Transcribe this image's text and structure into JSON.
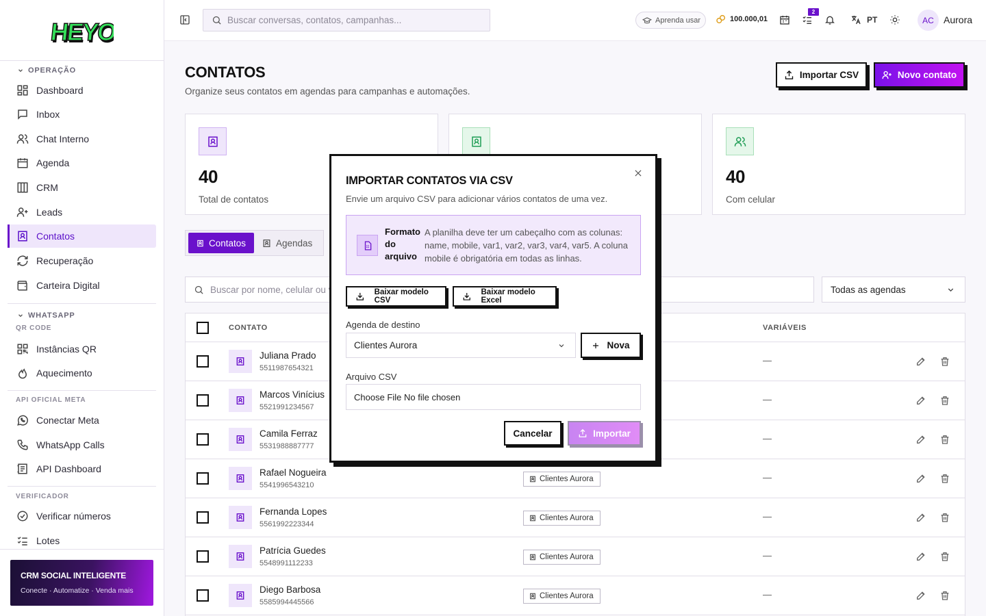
{
  "brand": {
    "logo_text": "HEYOO"
  },
  "sidebar": {
    "sections": [
      {
        "title": "OPERAÇÃO"
      },
      {
        "title": "WHATSAPP",
        "subtitle": "QR CODE"
      },
      {
        "title": "API OFICIAL META"
      },
      {
        "title": "VERIFICADOR"
      }
    ],
    "items": [
      {
        "label": "Dashboard",
        "icon": "grid-icon"
      },
      {
        "label": "Inbox",
        "icon": "inbox-icon"
      },
      {
        "label": "Chat Interno",
        "icon": "users-icon"
      },
      {
        "label": "Agenda",
        "icon": "calendar-icon"
      },
      {
        "label": "CRM",
        "icon": "columns-icon"
      },
      {
        "label": "Leads",
        "icon": "user-plus-icon"
      },
      {
        "label": "Contatos",
        "icon": "contact-book-icon",
        "active": true
      },
      {
        "label": "Recuperação",
        "icon": "refresh-icon"
      },
      {
        "label": "Carteira Digital",
        "icon": "wallet-icon"
      },
      {
        "label": "Instâncias QR",
        "icon": "qr-code-icon"
      },
      {
        "label": "Aquecimento",
        "icon": "flame-icon"
      },
      {
        "label": "Conectar Meta",
        "icon": "whatsapp-icon"
      },
      {
        "label": "WhatsApp Calls",
        "icon": "phone-icon"
      },
      {
        "label": "API Dashboard",
        "icon": "layout-icon"
      },
      {
        "label": "Verificar números",
        "icon": "check-circle-icon"
      },
      {
        "label": "Lotes",
        "icon": "list-checks-icon"
      }
    ],
    "promo": {
      "title": "CRM SOCIAL INTELIGENTE",
      "tagline": "Conecte · Automatize · Venda mais"
    }
  },
  "header": {
    "search_placeholder": "Buscar conversas, contatos, campanhas...",
    "learn_label": "Aprenda usar",
    "credits": "100.000,01",
    "tasks_badge": "2",
    "language": "PT",
    "user_initials": "AC",
    "user_name": "Aurora"
  },
  "page": {
    "title": "CONTATOS",
    "subtitle": "Organize seus contatos em agendas para campanhas e automações.",
    "import_button": "Importar CSV",
    "new_button": "Novo contato"
  },
  "stats": [
    {
      "value": "40",
      "label": "Total de contatos"
    },
    {
      "value": "",
      "label": ""
    },
    {
      "value": "40",
      "label": "Com celular"
    }
  ],
  "view_tabs": [
    {
      "label": "Contatos",
      "active": true
    },
    {
      "label": "Agendas",
      "active": false
    }
  ],
  "filters": {
    "search_placeholder": "Buscar por nome, celular ou va",
    "agenda_filter": "Todas as agendas"
  },
  "table": {
    "columns": [
      "CONTATO",
      "VARIÁVEIS"
    ],
    "rows": [
      {
        "name": "Juliana Prado",
        "phone": "5511987654321",
        "agenda": "",
        "vars": "—"
      },
      {
        "name": "Marcos Vinícius",
        "phone": "5521991234567",
        "agenda": "",
        "vars": "—"
      },
      {
        "name": "Camila Ferraz",
        "phone": "5531988887777",
        "agenda": "",
        "vars": "—"
      },
      {
        "name": "Rafael Nogueira",
        "phone": "5541996543210",
        "agenda": "Clientes Aurora",
        "vars": "—"
      },
      {
        "name": "Fernanda Lopes",
        "phone": "5561992223344",
        "agenda": "Clientes Aurora",
        "vars": "—"
      },
      {
        "name": "Patrícia Guedes",
        "phone": "5548991112233",
        "agenda": "Clientes Aurora",
        "vars": "—"
      },
      {
        "name": "Diego Barbosa",
        "phone": "5585994445566",
        "agenda": "Clientes Aurora",
        "vars": "—"
      }
    ]
  },
  "modal": {
    "title": "IMPORTAR CONTATOS VIA CSV",
    "description": "Envie um arquivo CSV para adicionar vários contatos de uma vez.",
    "format_heading": "Formato do arquivo",
    "format_text": "A planilha deve ter um cabeçalho com as colunas: name, mobile, var1, var2, var3, var4, var5. A coluna mobile é obrigatória em todas as linhas.",
    "download_csv": "Baixar modelo CSV",
    "download_excel": "Baixar modelo Excel",
    "agenda_label": "Agenda de destino",
    "agenda_value": "Clientes Aurora",
    "new_agenda_button": "Nova",
    "file_label": "Arquivo CSV",
    "file_value": "Choose File No file chosen",
    "cancel_button": "Cancelar",
    "submit_button": "Importar"
  },
  "colors": {
    "accent": "#6a11cb",
    "accent_light": "#efe6fb",
    "magenta": "#c112f0",
    "green": "#1f9d55"
  }
}
